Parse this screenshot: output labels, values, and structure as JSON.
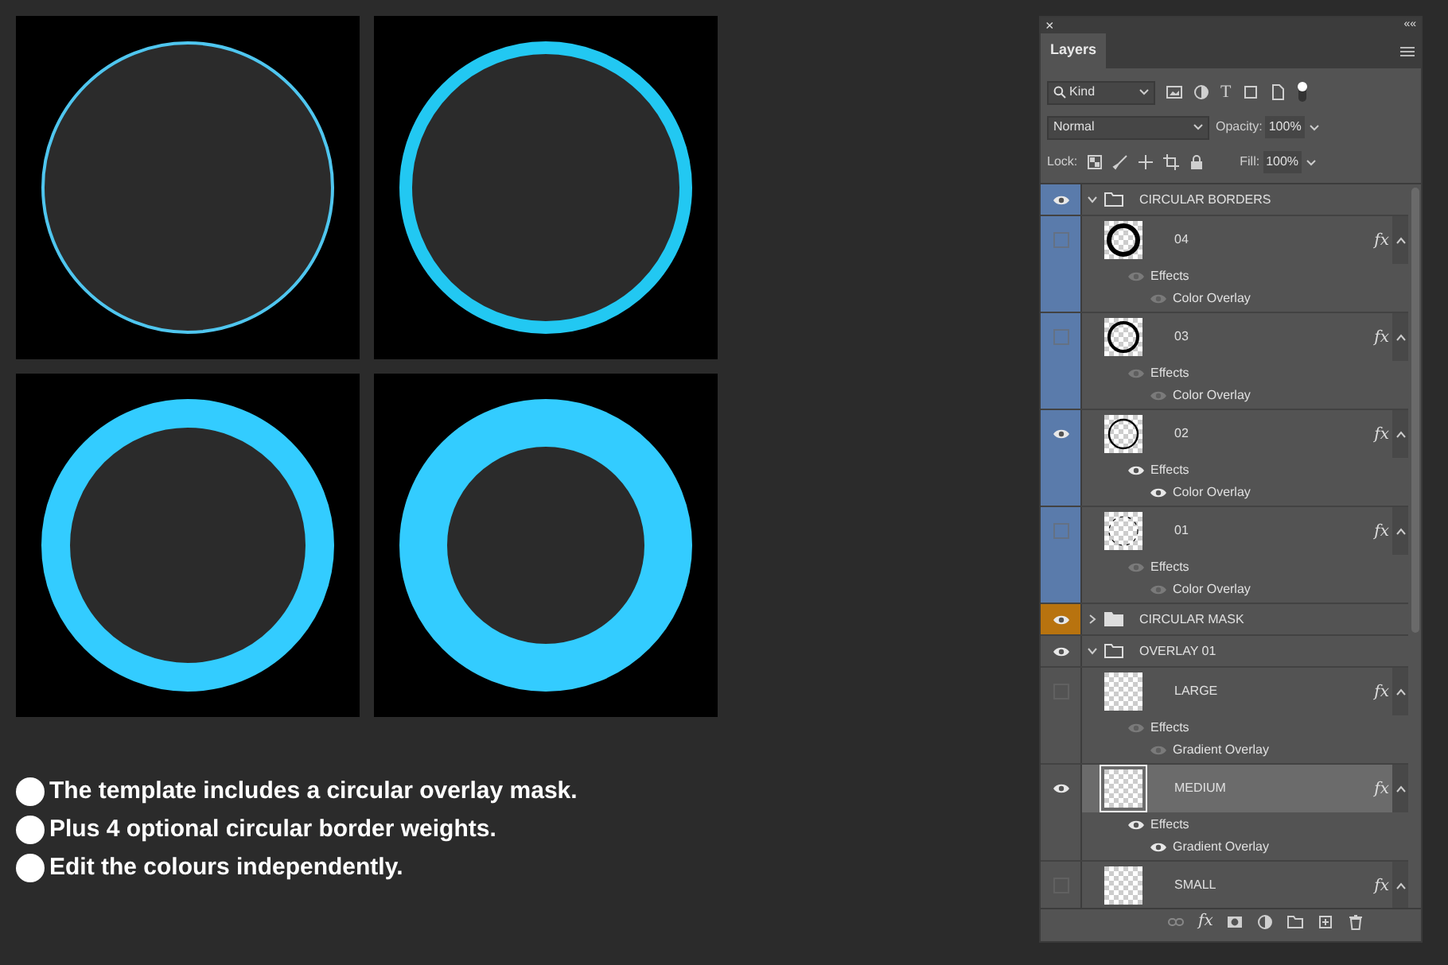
{
  "previews": [
    {
      "color": "#4fc6ef"
    },
    {
      "color": "#22c8f2"
    },
    {
      "color": "#33ccff"
    },
    {
      "color": "#33ccff"
    }
  ],
  "notes": [
    "The template includes a circular overlay mask.",
    "Plus 4 optional circular border weights.",
    "Edit the colours independently."
  ],
  "panel": {
    "close": "×",
    "collapse": "««",
    "tab": "Layers",
    "filter": "Kind",
    "type_tool": "T",
    "blend_mode": "Normal",
    "opacity_label": "Opacity:",
    "opacity": "100%",
    "lock_label": "Lock:",
    "fill_label": "Fill:",
    "fill": "100%",
    "layers": [
      {
        "kind": "group",
        "name": "CIRCULAR BORDERS",
        "visible": true,
        "expanded": true,
        "color": "#5a7bab",
        "children": [
          {
            "kind": "layer",
            "name": "04",
            "visible": false,
            "selected": false,
            "fx": "fx",
            "effects": {
              "label": "Effects",
              "visible": false,
              "items": [
                {
                  "label": "Color Overlay",
                  "visible": false
                }
              ]
            }
          },
          {
            "kind": "layer",
            "name": "03",
            "visible": false,
            "selected": false,
            "fx": "fx",
            "effects": {
              "label": "Effects",
              "visible": false,
              "items": [
                {
                  "label": "Color Overlay",
                  "visible": false
                }
              ]
            }
          },
          {
            "kind": "layer",
            "name": "02",
            "visible": true,
            "selected": false,
            "fx": "fx",
            "effects": {
              "label": "Effects",
              "visible": true,
              "items": [
                {
                  "label": "Color Overlay",
                  "visible": true
                }
              ]
            }
          },
          {
            "kind": "layer",
            "name": "01",
            "visible": false,
            "selected": false,
            "fx": "fx",
            "effects": {
              "label": "Effects",
              "visible": false,
              "items": [
                {
                  "label": "Color Overlay",
                  "visible": false
                }
              ]
            }
          }
        ]
      },
      {
        "kind": "group",
        "name": "CIRCULAR MASK",
        "visible": true,
        "expanded": false,
        "color": "#b8730f"
      },
      {
        "kind": "group",
        "name": "OVERLAY 01",
        "visible": true,
        "expanded": true,
        "children": [
          {
            "kind": "layer",
            "name": "LARGE",
            "visible": false,
            "selected": false,
            "fx": "fx",
            "effects": {
              "label": "Effects",
              "visible": false,
              "items": [
                {
                  "label": "Gradient Overlay",
                  "visible": false
                }
              ]
            }
          },
          {
            "kind": "layer",
            "name": "MEDIUM",
            "visible": true,
            "selected": true,
            "fx": "fx",
            "effects": {
              "label": "Effects",
              "visible": true,
              "items": [
                {
                  "label": "Gradient Overlay",
                  "visible": true
                }
              ]
            }
          },
          {
            "kind": "layer",
            "name": "SMALL",
            "visible": false,
            "selected": false,
            "fx": "fx"
          }
        ]
      }
    ],
    "footer_fx": "fx"
  }
}
